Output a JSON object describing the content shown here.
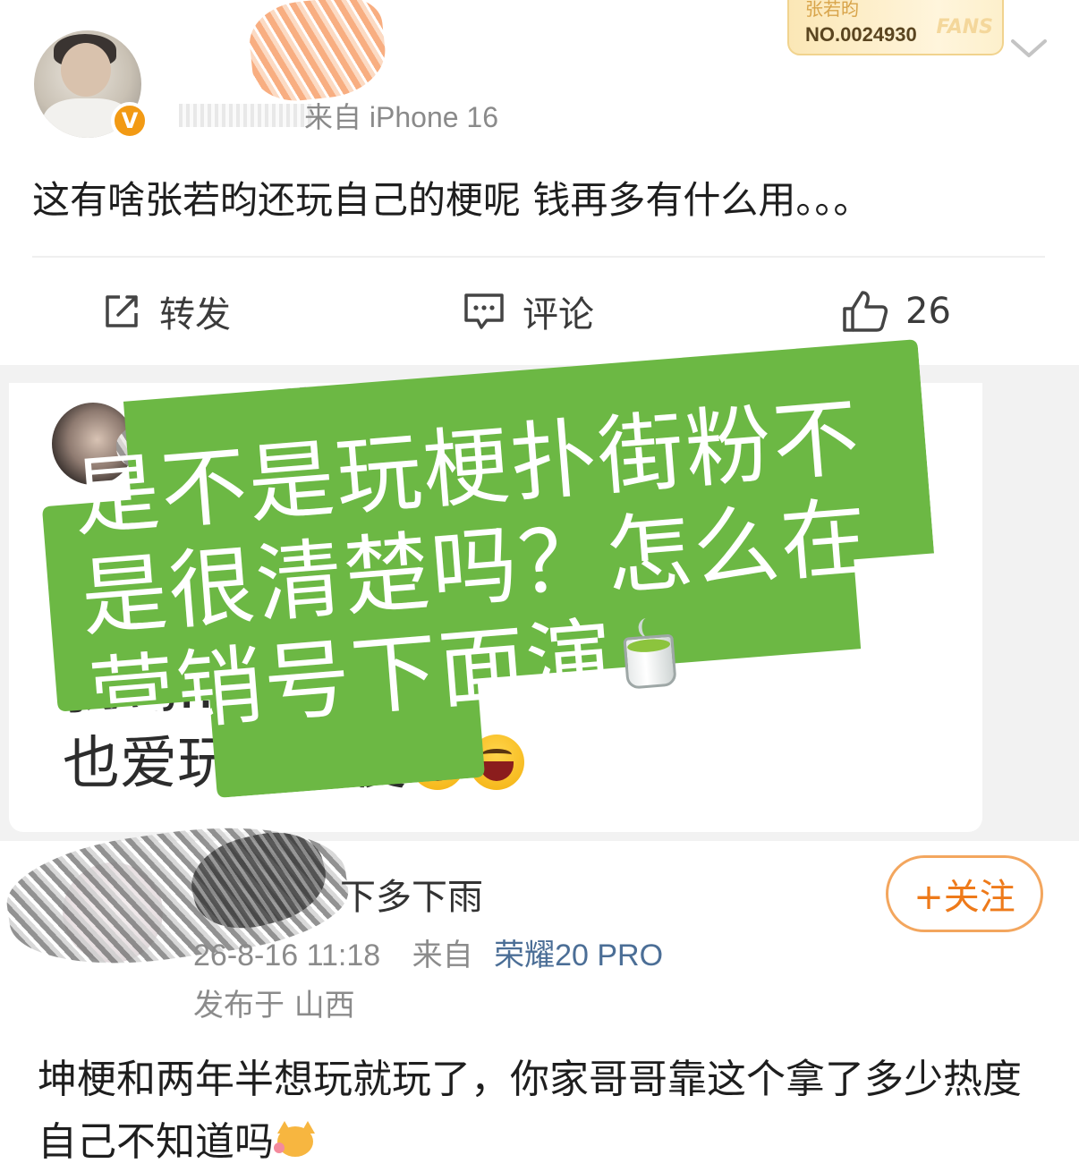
{
  "post1": {
    "meta_from": "来自 iPhone 16",
    "fans_badge": {
      "name": "张若昀",
      "number": "NO.0024930",
      "tag": "FANS"
    },
    "verified_mark": "V",
    "content": "这有啥张若昀还玩自己的梗呢 钱再多有什么用。。。",
    "actions": {
      "repost_label": "转发",
      "comment_label": "评论",
      "like_count": "26"
    }
  },
  "quoted_card": {
    "content_partial": "我也…的时候我",
    "content_line2": "也爱玩这个梗"
  },
  "overlay_callout": {
    "text": "是不是玩梗扑街粉不是很清楚吗？怎么在营销号下面演",
    "color": "#6cb844"
  },
  "post2": {
    "name_partial": "下多下雨",
    "follow_button": "+关注",
    "timestamp": "26-8-16 11:18",
    "from_label": "来自",
    "device": "荣耀20 PRO",
    "location": "发布于 山西",
    "content": "坤梗和两年半想玩就玩了，你家哥哥靠这个拿了多少热度自己不知道吗"
  },
  "colors": {
    "accent_orange": "#ee7a1a",
    "device_blue": "#4b6e96",
    "verified_orange": "#f29a14"
  }
}
